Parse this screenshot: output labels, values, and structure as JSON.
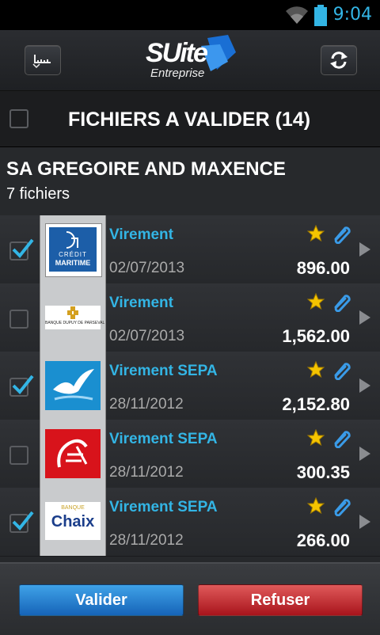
{
  "status_bar": {
    "time": "9:04",
    "wifi_icon": "wifi-icon",
    "battery_icon": "battery-icon",
    "accent": "#33b5e5"
  },
  "app_bar": {
    "left_icon": "ruler-tool-icon",
    "right_icon": "refresh-icon",
    "logo_main": "SUite",
    "logo_sub": "Entreprise"
  },
  "header": {
    "title": "FICHIERS A VALIDER (14)",
    "select_all_checked": false
  },
  "group": {
    "company": "SA GREGOIRE AND MAXENCE",
    "file_count": "7 fichiers"
  },
  "rows": [
    {
      "title": "Virement",
      "date": "02/07/2013",
      "amount": "896.00",
      "checked": true,
      "bank": "credit-maritime",
      "bank_text_1": "CRÉDIT",
      "bank_text_2": "MARITIME"
    },
    {
      "title": "Virement",
      "date": "02/07/2013",
      "amount": "1,562.00",
      "checked": false,
      "bank": "banque-dupuy-de-parseval",
      "bank_text_1": "BANQUE DUPUY DE PARSEVAL"
    },
    {
      "title": "Virement SEPA",
      "date": "28/11/2012",
      "amount": "2,152.80",
      "checked": true,
      "bank": "banque-populaire"
    },
    {
      "title": "Virement SEPA",
      "date": "28/11/2012",
      "amount": "300.35",
      "checked": false,
      "bank": "caisse-epargne"
    },
    {
      "title": "Virement SEPA",
      "date": "28/11/2012",
      "amount": "266.00",
      "checked": true,
      "bank": "banque-chaix",
      "bank_text_1": "BANQUE",
      "bank_text_2": "Chaix"
    }
  ],
  "actions": {
    "validate_label": "Valider",
    "refuse_label": "Refuser"
  },
  "colors": {
    "link_blue": "#33b5e5",
    "validate": "#1e7fd6",
    "refuse": "#c8222a",
    "star": "#f5c400",
    "clip": "#3a9be8"
  }
}
